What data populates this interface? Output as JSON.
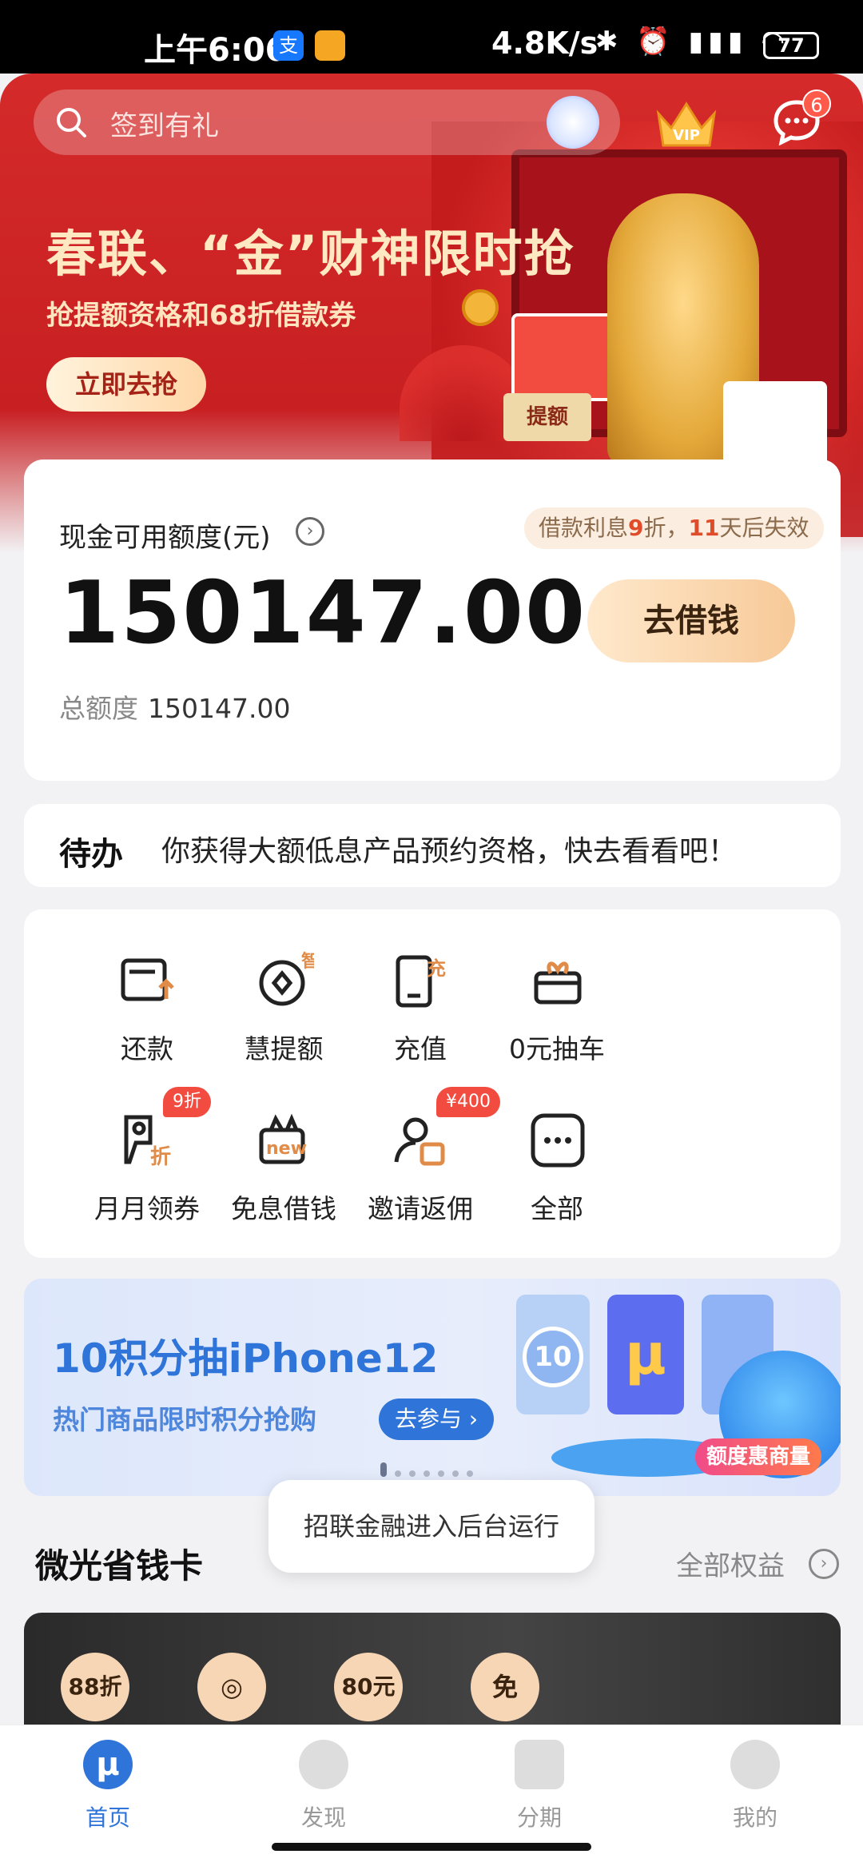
{
  "status_bar": {
    "time": "上午6:06",
    "app1": "支",
    "speed": "4.8K/s",
    "icons": "✱ ⏰ ▮▮▮ ◠",
    "battery": "77"
  },
  "header": {
    "search_placeholder": "签到有礼",
    "vip_label": "VIP",
    "message_badge": "6"
  },
  "banner": {
    "headline": "春联、“金”财神限时抢",
    "subline": "抢提额资格和68折借款券",
    "button": "立即去抢",
    "tag": "提额"
  },
  "credit": {
    "label": "现金可用额度(元)",
    "amount": "150147.00",
    "total_label": "总额度",
    "total_value": "150147.00",
    "promo_pre": "借款利息",
    "promo_num1": "9",
    "promo_mid": "折，",
    "promo_num2": "11",
    "promo_post": "天后失效",
    "borrow_button": "去借钱"
  },
  "todo": {
    "label": "待办",
    "text": "你获得大额低息产品预约资格，快去看看吧！"
  },
  "services": [
    {
      "label": "还款",
      "icon": "repay-icon",
      "badge": ""
    },
    {
      "label": "慧提额",
      "icon": "smart-raise-icon",
      "badge": ""
    },
    {
      "label": "充值",
      "icon": "recharge-icon",
      "badge": ""
    },
    {
      "label": "0元抽车",
      "icon": "gift-icon",
      "badge": ""
    },
    {
      "label": "月月领券",
      "icon": "coupon-icon",
      "badge": "9折"
    },
    {
      "label": "免息借钱",
      "icon": "interest-free-icon",
      "badge": ""
    },
    {
      "label": "邀请返佣",
      "icon": "invite-icon",
      "badge": "¥400"
    },
    {
      "label": "全部",
      "icon": "more-icon",
      "badge": ""
    }
  ],
  "promo": {
    "title": "10积分抽iPhone12",
    "subtitle": "热门商品限时积分抢购",
    "button": "去参与 ›",
    "card_number": "10",
    "card_mu": "μ",
    "badge": "额度惠商量"
  },
  "toast": "招联金融进入后台运行",
  "savings": {
    "title": "微光省钱卡",
    "more": "全部权益",
    "items": [
      "88折",
      "◎",
      "80元",
      "免"
    ]
  },
  "bottom_nav": [
    {
      "label": "首页",
      "active": true
    },
    {
      "label": "发现",
      "active": false
    },
    {
      "label": "分期",
      "active": false
    },
    {
      "label": "我的",
      "active": false
    }
  ],
  "colors": {
    "brand_red": "#c81f22",
    "accent_blue": "#2f74d8",
    "gold": "#f7c998"
  }
}
